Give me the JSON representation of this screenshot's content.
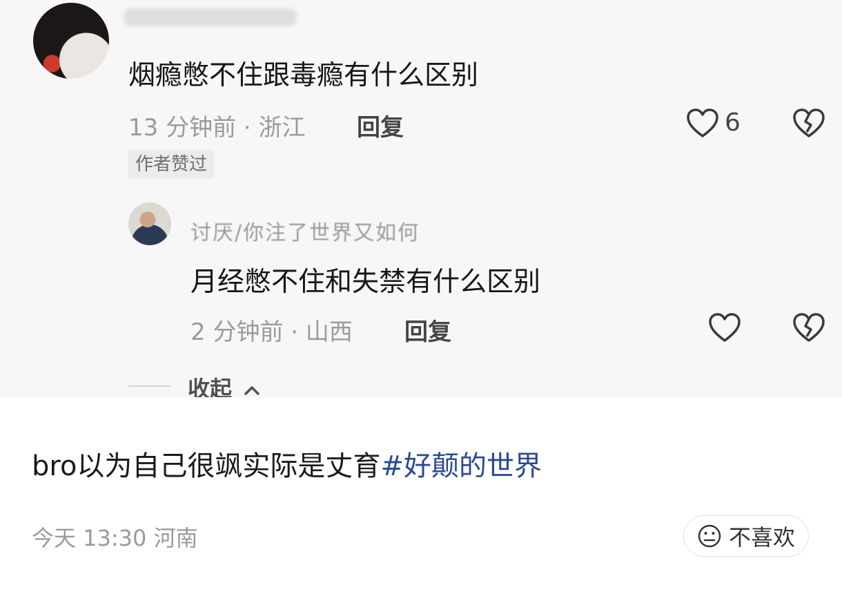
{
  "screenshot": {
    "comment_1": {
      "text": "烟瘾憋不住跟毒瘾有什么区别",
      "time_location": "13 分钟前 · 浙江",
      "reply_label": "回复",
      "like_count": "6",
      "badge": "作者赞过"
    },
    "comment_2": {
      "username_partial": "讨厌/你注了世界又如何",
      "text": "月经憋不住和失禁有什么区别",
      "time_location": "2 分钟前 · 山西",
      "reply_label": "回复"
    },
    "collapse_label": "收起"
  },
  "post": {
    "caption_text": "bro以为自己很飒实际是丈育",
    "hashtag": "#好颠的世界",
    "timestamp": "今天 13:30",
    "location": "河南",
    "dislike_label": "不喜欢"
  },
  "colors": {
    "hashtag": "#2a4a8f",
    "meta_gray": "#9b9b9b",
    "background": "#ffffff"
  },
  "icons": [
    "heart-icon",
    "broken-heart-icon",
    "chevron-up-icon",
    "neutral-face-icon"
  ]
}
